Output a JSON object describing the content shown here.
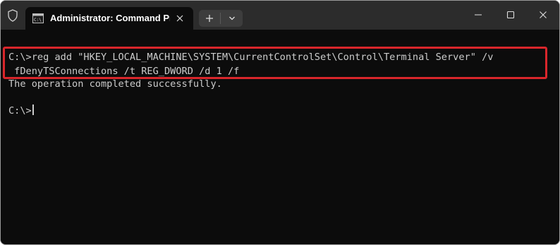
{
  "window": {
    "tab_title": "Administrator: Command Pro",
    "icons": {
      "shield": "shield-icon",
      "tab": "cmd-icon",
      "tab_close": "close-icon",
      "new_tab": "plus-icon",
      "dropdown": "chevron-down-icon",
      "minimize": "minimize-icon",
      "maximize": "maximize-icon",
      "close": "close-icon"
    },
    "colors": {
      "titlebar": "#2c2c2c",
      "terminal_bg": "#0c0c0c",
      "text": "#cccccc",
      "highlight_border": "#d9262b"
    }
  },
  "terminal": {
    "lines": [
      "C:\\>reg add \"HKEY_LOCAL_MACHINE\\SYSTEM\\CurrentControlSet\\Control\\Terminal Server\" /v",
      " fDenyTSConnections /t REG_DWORD /d 1 /f",
      "The operation completed successfully.",
      "C:\\>"
    ]
  }
}
